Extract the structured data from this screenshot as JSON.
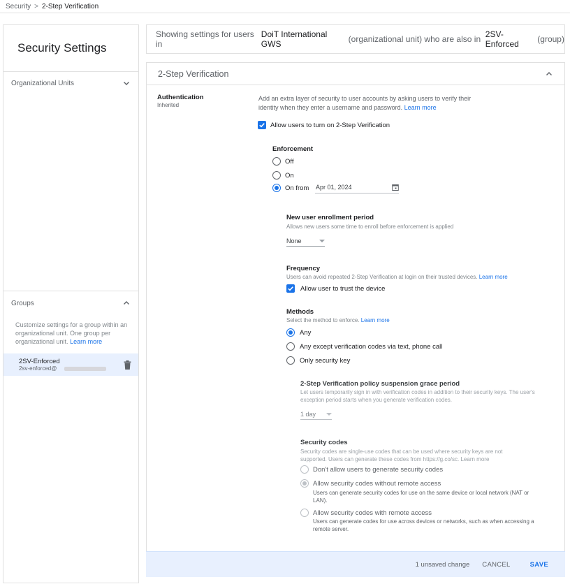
{
  "breadcrumb": {
    "parent": "Security",
    "current": "2-Step Verification"
  },
  "sidebar": {
    "title": "Security Settings",
    "org_units_label": "Organizational Units",
    "groups_label": "Groups",
    "groups_desc": "Customize settings for a group within an organizational unit. One group per organizational unit.",
    "groups_learn_more": "Learn more",
    "group_item": {
      "name": "2SV-Enforced",
      "email": "2sv-enforced@"
    }
  },
  "banner": {
    "prefix": "Showing settings for users in ",
    "org": "DoiT International GWS",
    "middle": " (organizational unit) who are also in ",
    "group": "2SV-Enforced",
    "suffix": " (group)"
  },
  "panel": {
    "title": "2-Step Verification",
    "auth_label": "Authentication",
    "auth_sub": "Inherited",
    "auth_desc": "Add an extra layer of security to user accounts by asking users to verify their identity when they enter a username and password.",
    "learn_more": "Learn more",
    "allow_label": "Allow users to turn on 2-Step Verification",
    "enforcement": {
      "title": "Enforcement",
      "off": "Off",
      "on": "On",
      "on_from": "On from",
      "date": "Apr 01, 2024"
    },
    "enrollment": {
      "title": "New user enrollment period",
      "desc": "Allows new users some time to enroll before enforcement is applied",
      "value": "None"
    },
    "frequency": {
      "title": "Frequency",
      "desc": "Users can avoid repeated 2-Step Verification at login on their trusted devices.",
      "learn_more": "Learn more",
      "trust_label": "Allow user to trust the device"
    },
    "methods": {
      "title": "Methods",
      "desc": "Select the method to enforce.",
      "learn_more": "Learn more",
      "any": "Any",
      "any_except": "Any except verification codes via text, phone call",
      "only_key": "Only security key"
    },
    "grace": {
      "title": "2-Step Verification policy suspension grace period",
      "desc": "Let users temporarily sign in with verification codes in addition to their security keys. The user's exception period starts when you generate verification codes.",
      "value": "1 day"
    },
    "codes": {
      "title": "Security codes",
      "desc_prefix": "Security codes are single-use codes that can be used where security keys are not supported. Users can generate these codes from ",
      "desc_link": "https://g.co/sc",
      "desc_suffix": ".",
      "learn_more": "Learn more",
      "opt1": "Don't allow users to generate security codes",
      "opt2": "Allow security codes without remote access",
      "opt2_desc": "Users can generate security codes for use on the same device or local network (NAT or LAN).",
      "opt3": "Allow security codes with remote access",
      "opt3_desc": "Users can generate codes for use across devices or networks, such as when accessing a remote server."
    }
  },
  "footer": {
    "unsaved": "1 unsaved change",
    "cancel": "CANCEL",
    "save": "SAVE"
  },
  "colors": {
    "accent": "#1a73e8",
    "footer_bg": "#e8f0fe",
    "selected_bg": "#e8f0fe"
  }
}
